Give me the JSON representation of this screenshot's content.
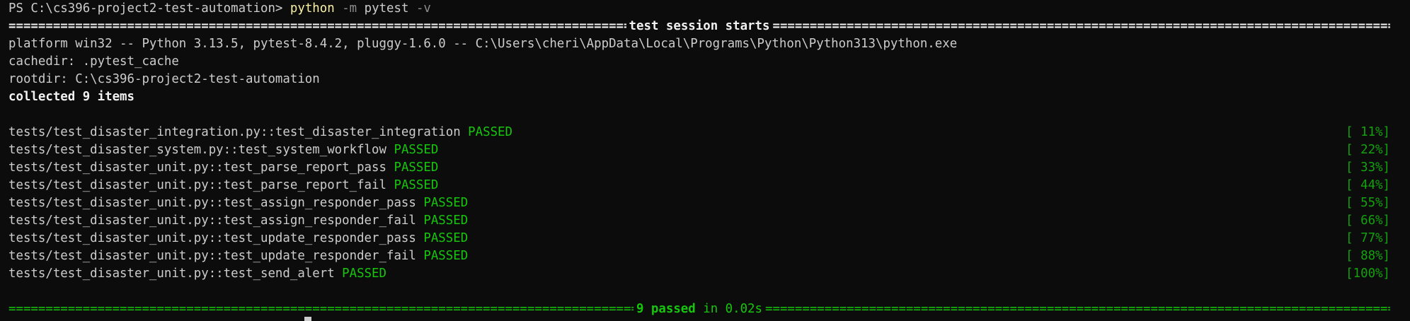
{
  "prompt": {
    "ps": "PS C:\\cs396-project2-test-automation>",
    "cmd": "python",
    "flag": "-m",
    "module": "pytest",
    "opt": "-v"
  },
  "session": {
    "title": "test session starts",
    "platform": "platform win32 -- Python 3.13.5, pytest-8.4.2, pluggy-1.6.0 -- C:\\Users\\cheri\\AppData\\Local\\Programs\\Python\\Python313\\python.exe",
    "cachedir": "cachedir: .pytest_cache",
    "rootdir": "rootdir: C:\\cs396-project2-test-automation",
    "collected": "collected 9 items"
  },
  "tests": [
    {
      "name": "tests/test_disaster_integration.py::test_disaster_integration",
      "status": "PASSED",
      "pct": "[ 11%]"
    },
    {
      "name": "tests/test_disaster_system.py::test_system_workflow",
      "status": "PASSED",
      "pct": "[ 22%]"
    },
    {
      "name": "tests/test_disaster_unit.py::test_parse_report_pass",
      "status": "PASSED",
      "pct": "[ 33%]"
    },
    {
      "name": "tests/test_disaster_unit.py::test_parse_report_fail",
      "status": "PASSED",
      "pct": "[ 44%]"
    },
    {
      "name": "tests/test_disaster_unit.py::test_assign_responder_pass",
      "status": "PASSED",
      "pct": "[ 55%]"
    },
    {
      "name": "tests/test_disaster_unit.py::test_assign_responder_fail",
      "status": "PASSED",
      "pct": "[ 66%]"
    },
    {
      "name": "tests/test_disaster_unit.py::test_update_responder_pass",
      "status": "PASSED",
      "pct": "[ 77%]"
    },
    {
      "name": "tests/test_disaster_unit.py::test_update_responder_fail",
      "status": "PASSED",
      "pct": "[ 88%]"
    },
    {
      "name": "tests/test_disaster_unit.py::test_send_alert",
      "status": "PASSED",
      "pct": "[100%]"
    }
  ],
  "summary": {
    "passed": "9 passed",
    "time": "in 0.02s"
  },
  "colors": {
    "background": "#0c0c0c",
    "text": "#cccccc",
    "pass_green": "#16c60c",
    "command_yellow": "#f9f1a5"
  }
}
